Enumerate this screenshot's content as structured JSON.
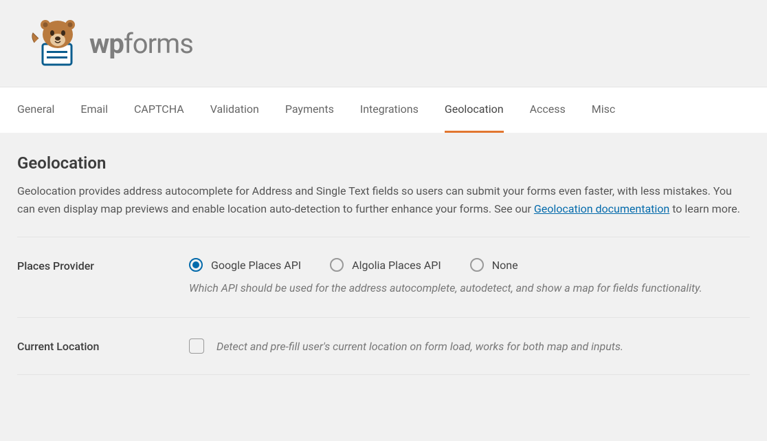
{
  "logo": {
    "wp": "wp",
    "forms": "forms"
  },
  "tabs": [
    {
      "label": "General",
      "active": false
    },
    {
      "label": "Email",
      "active": false
    },
    {
      "label": "CAPTCHA",
      "active": false
    },
    {
      "label": "Validation",
      "active": false
    },
    {
      "label": "Payments",
      "active": false
    },
    {
      "label": "Integrations",
      "active": false
    },
    {
      "label": "Geolocation",
      "active": true
    },
    {
      "label": "Access",
      "active": false
    },
    {
      "label": "Misc",
      "active": false
    }
  ],
  "page": {
    "title": "Geolocation",
    "desc_before": "Geolocation provides address autocomplete for Address and Single Text fields so users can submit your forms even faster, with less mistakes. You can even display map previews and enable location auto-detection to further enhance your forms. See our ",
    "desc_link": "Geolocation documentation",
    "desc_after": " to learn more."
  },
  "settings": {
    "places_provider": {
      "label": "Places Provider",
      "options": [
        {
          "label": "Google Places API",
          "checked": true
        },
        {
          "label": "Algolia Places API",
          "checked": false
        },
        {
          "label": "None",
          "checked": false
        }
      ],
      "help": "Which API should be used for the address autocomplete, autodetect, and show a map for fields functionality."
    },
    "current_location": {
      "label": "Current Location",
      "checkbox_label": "Detect and pre-fill user's current location on form load, works for both map and inputs.",
      "checked": false
    }
  }
}
